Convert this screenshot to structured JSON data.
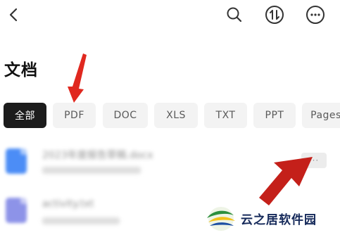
{
  "header": {
    "back_icon": "chevron-left-icon",
    "search_icon": "search-icon",
    "sort_icon": "sort-updown-icon",
    "more_icon": "more-horizontal-icon"
  },
  "page": {
    "title": "文档"
  },
  "filter_tabs": [
    {
      "label": "全部",
      "active": true
    },
    {
      "label": "PDF",
      "active": false
    },
    {
      "label": "DOC",
      "active": false
    },
    {
      "label": "XLS",
      "active": false
    },
    {
      "label": "TXT",
      "active": false
    },
    {
      "label": "PPT",
      "active": false
    },
    {
      "label": "Pages",
      "active": false
    }
  ],
  "files": [
    {
      "name": "2023年度报告草稿.docx",
      "icon": "document-icon",
      "icon_color": "#4c8df6",
      "more_label": "···"
    },
    {
      "name": "activity.txt",
      "icon": "text-file-icon",
      "icon_color": "#8d93e8"
    }
  ],
  "watermark": {
    "text": "云之居软件园"
  },
  "colors": {
    "active_tab_bg": "#1c1c1c",
    "tab_bg": "#f3f3f3",
    "annotation_arrow": "#e0281f"
  }
}
